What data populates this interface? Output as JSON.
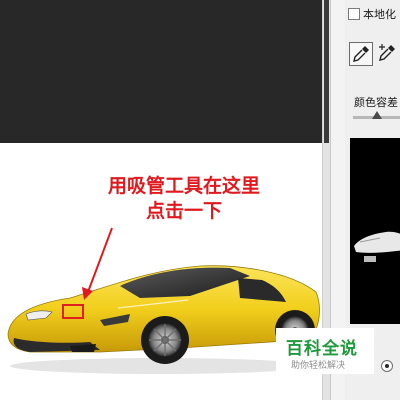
{
  "annotation": {
    "line1": "用吸管工具在这里",
    "line2": "点击一下"
  },
  "panel": {
    "localized_checkbox_label": "本地化",
    "color_tolerance_label": "颜色容差",
    "eyedropper_tool": "eyedropper-icon",
    "eyedropper_plus_tool": "eyedropper-plus-icon"
  },
  "watermark": {
    "title": "百科全说",
    "subtitle": "助你轻松解决"
  },
  "colors": {
    "annotation": "#e0191e",
    "car_body": "#f2cf1c",
    "watermark": "#1f9a3a",
    "canvas_dark": "#282828"
  }
}
